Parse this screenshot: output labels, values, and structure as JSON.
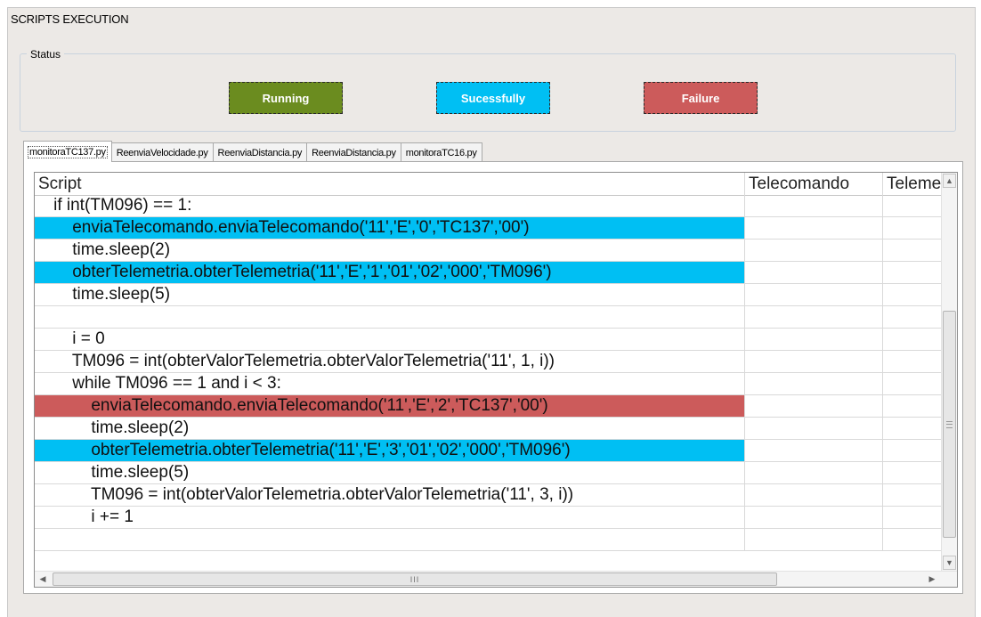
{
  "window": {
    "title": "SCRIPTS EXECUTION"
  },
  "status": {
    "label": "Status",
    "items": [
      {
        "label": "Running",
        "color": "#6b8c1f"
      },
      {
        "label": "Sucessfully",
        "color": "#00bff3"
      },
      {
        "label": "Failure",
        "color": "#cc5b5b"
      }
    ]
  },
  "tabs": [
    {
      "label": "monitoraTC137.py",
      "active": true
    },
    {
      "label": "ReenviaVelocidade.py",
      "active": false
    },
    {
      "label": "ReenviaDistancia.py",
      "active": false
    },
    {
      "label": "ReenviaDistancia.py",
      "active": false
    },
    {
      "label": "monitoraTC16.py",
      "active": false
    }
  ],
  "grid": {
    "columns": [
      "Script",
      "Telecomando",
      "Telemetria"
    ],
    "rows": [
      {
        "script": "    if int(TM096) == 1:",
        "highlight": "none"
      },
      {
        "script": "        enviaTelecomando.enviaTelecomando('11','E','0','TC137','00')",
        "highlight": "blue"
      },
      {
        "script": "        time.sleep(2)",
        "highlight": "none"
      },
      {
        "script": "        obterTelemetria.obterTelemetria('11','E','1','01','02','000','TM096')",
        "highlight": "blue"
      },
      {
        "script": "        time.sleep(5)",
        "highlight": "none"
      },
      {
        "script": "",
        "highlight": "none"
      },
      {
        "script": "        i = 0",
        "highlight": "none"
      },
      {
        "script": "        TM096 = int(obterValorTelemetria.obterValorTelemetria('11', 1, i))",
        "highlight": "none"
      },
      {
        "script": "        while TM096 == 1 and i < 3:",
        "highlight": "none"
      },
      {
        "script": "            enviaTelecomando.enviaTelecomando('11','E','2','TC137','00')",
        "highlight": "red"
      },
      {
        "script": "            time.sleep(2)",
        "highlight": "none"
      },
      {
        "script": "            obterTelemetria.obterTelemetria('11','E','3','01','02','000','TM096')",
        "highlight": "blue"
      },
      {
        "script": "            time.sleep(5)",
        "highlight": "none"
      },
      {
        "script": "            TM096 = int(obterValorTelemetria.obterValorTelemetria('11', 3, i))",
        "highlight": "none"
      },
      {
        "script": "            i += 1",
        "highlight": "none"
      },
      {
        "script": "",
        "highlight": "none"
      }
    ]
  },
  "scrollbars": {
    "up": "▲",
    "down": "▼",
    "left": "◀",
    "right": "▶",
    "grip": "III"
  }
}
